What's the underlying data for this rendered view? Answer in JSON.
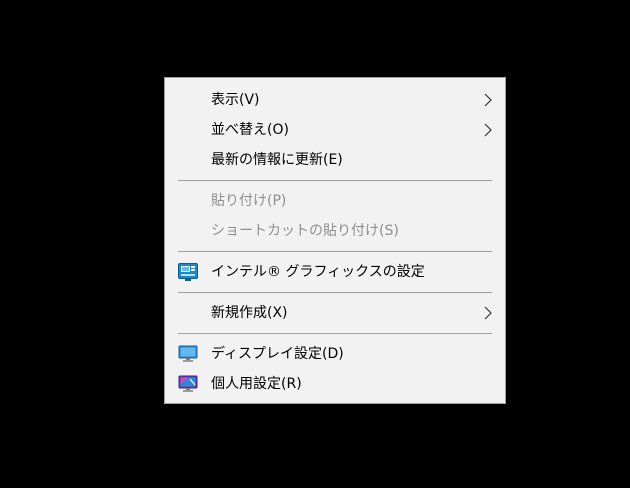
{
  "context_menu": {
    "items": {
      "view": {
        "label": "表示(V)",
        "icon": "chevron-right-icon"
      },
      "sort": {
        "label": "並べ替え(O)",
        "icon": "chevron-right-icon"
      },
      "refresh": {
        "label": "最新の情報に更新(E)"
      },
      "paste": {
        "label": "貼り付け(P)",
        "disabled": true
      },
      "paste_shortcut": {
        "label": "ショートカットの貼り付け(S)",
        "disabled": true
      },
      "intel": {
        "label": "インテル® グラフィックスの設定",
        "icon": "intel-graphics-icon"
      },
      "new": {
        "label": "新規作成(X)",
        "icon": "chevron-right-icon"
      },
      "display": {
        "label": "ディスプレイ設定(D)",
        "icon": "display-settings-icon"
      },
      "personalize": {
        "label": "個人用設定(R)",
        "icon": "personalize-icon"
      }
    }
  },
  "colors": {
    "menu_background": "#f2f2f2",
    "menu_border": "#a0a0a0",
    "disabled_text": "#8e8e8e",
    "desktop": "#000000"
  }
}
